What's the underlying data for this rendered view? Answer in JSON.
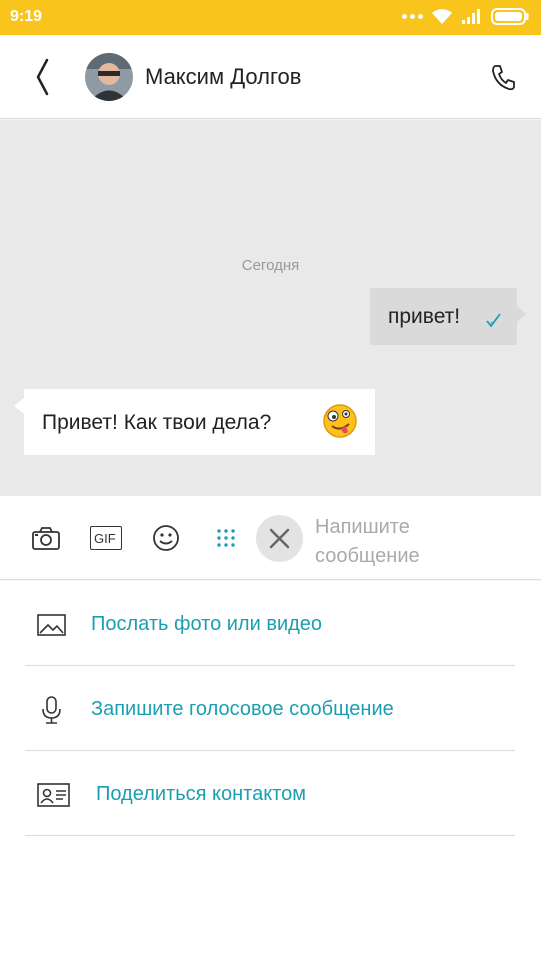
{
  "status_bar": {
    "time": "9:19"
  },
  "header": {
    "contact_name": "Максим Долгов"
  },
  "chat": {
    "date_label": "Сегодня",
    "outgoing_text": "привет!",
    "incoming_text": "Привет! Как твои дела?"
  },
  "toolbar": {
    "gif_label": "GIF",
    "placeholder_line1": "Напишите",
    "placeholder_line2": "сообщение"
  },
  "options": [
    {
      "label": "Послать фото или видео",
      "icon": "image-icon"
    },
    {
      "label": "Запишите голосовое сообщение",
      "icon": "microphone-icon"
    },
    {
      "label": "Поделиться контактом",
      "icon": "contact-card-icon"
    }
  ],
  "colors": {
    "status_bar": "#f9c51c",
    "accent": "#1b9fb0",
    "chat_bg": "#e9e9e9"
  }
}
